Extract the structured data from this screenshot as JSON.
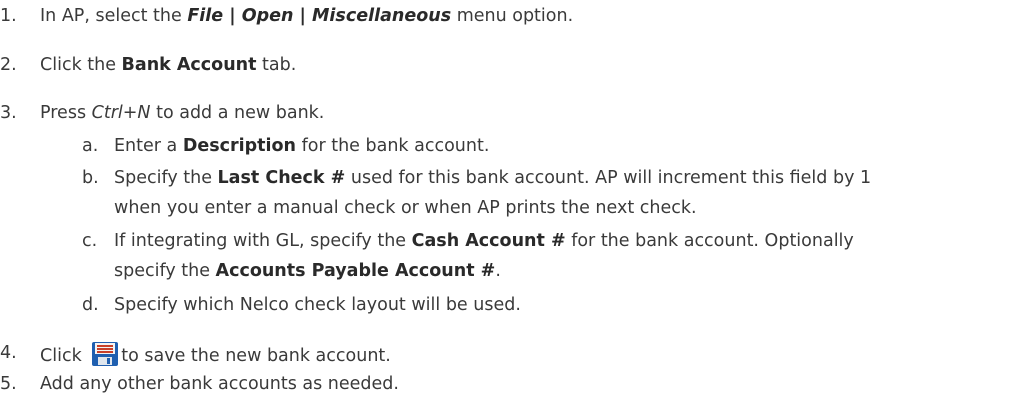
{
  "steps": [
    {
      "num": "1.",
      "parts": [
        "In AP, select the ",
        "File | Open | Miscellaneous",
        " menu option."
      ]
    },
    {
      "num": "2.",
      "parts": [
        "Click the ",
        "Bank Account",
        " tab."
      ]
    },
    {
      "num": "3.",
      "parts": [
        "Press ",
        "Ctrl+N",
        " to add a new bank."
      ]
    },
    {
      "num": "4.",
      "parts": [
        "Click ",
        "to save the new bank account."
      ]
    },
    {
      "num": "5.",
      "parts": [
        "Add any other bank accounts as needed."
      ]
    }
  ],
  "substeps": [
    {
      "letter": "a.",
      "parts": [
        "Enter a ",
        "Description",
        " for the bank account."
      ]
    },
    {
      "letter": "b.",
      "parts": [
        "Specify the ",
        "Last Check #",
        " used for this bank account. AP will increment this field by 1"
      ],
      "cont": "when you enter a manual check or when AP prints the next check."
    },
    {
      "letter": "c.",
      "parts": [
        "If integrating with GL, specify the ",
        "Cash Account #",
        " for the bank account. Optionally"
      ],
      "cont_parts": [
        "specify the ",
        "Accounts Payable Account #",
        "."
      ]
    },
    {
      "letter": "d.",
      "parts": [
        "Specify which Nelco check layout will be used."
      ]
    }
  ],
  "icons": {
    "save": "save-floppy-icon"
  },
  "colors": {
    "text": "#3a3a3a",
    "icon_blue": "#1f5fb0",
    "icon_red": "#c8402a"
  }
}
